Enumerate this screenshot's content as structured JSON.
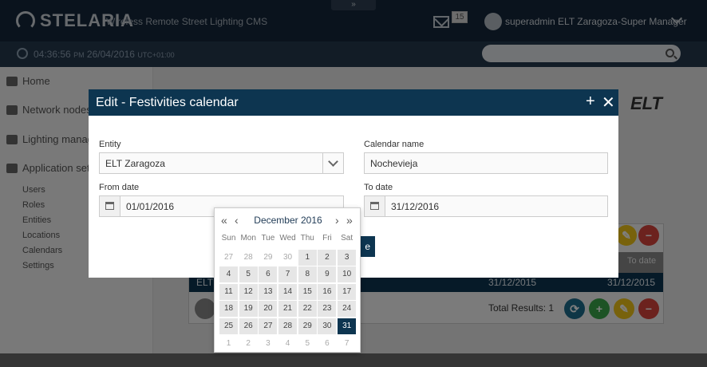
{
  "topbar": {
    "collapse_glyph": "»",
    "brand": "STELARIA",
    "subtitle": "Wireless Remote Street Lighting CMS",
    "mail_count": "15",
    "user": "superadmin  ELT Zaragoza-Super Manager"
  },
  "clock": {
    "time": "04:36:56",
    "ampm": "PM",
    "date": "26/04/2016",
    "tz": "UTC+01:00"
  },
  "sidebar": {
    "items": [
      {
        "label": "Home",
        "icon": "home-icon"
      },
      {
        "label": "Network nodes",
        "icon": "network-icon"
      },
      {
        "label": "Lighting manag",
        "icon": "signal-icon"
      },
      {
        "label": "Application setu",
        "icon": "gear-icon"
      }
    ],
    "subitems": [
      "Users",
      "Roles",
      "Entities",
      "Locations",
      "Calendars",
      "Settings"
    ]
  },
  "background": {
    "brand_logo": "ELT",
    "table_header_to_date": "To date",
    "row_entity": "ELT",
    "row_from": "31/12/2015",
    "row_to": "31/12/2015",
    "total": "Total Results: 1"
  },
  "modal": {
    "title": "Edit - Festivities calendar",
    "plus_glyph": "+",
    "close_glyph": "✕",
    "entity_label": "Entity",
    "entity_value": "ELT Zaragoza",
    "calendar_name_label": "Calendar name",
    "calendar_name_value": "Nochevieja",
    "from_label": "From date",
    "from_value": "01/01/2016",
    "to_label": "To date",
    "to_value": "31/12/2016",
    "save_fragment": "e"
  },
  "datepicker": {
    "month_title": "December 2016",
    "prev_year": "«",
    "prev_month": "‹",
    "next_month": "›",
    "next_year": "»",
    "weekdays": [
      "Sun",
      "Mon",
      "Tue",
      "Wed",
      "Thu",
      "Fri",
      "Sat"
    ],
    "selected_day": "31",
    "days": [
      {
        "d": "27",
        "other": true
      },
      {
        "d": "28",
        "other": true
      },
      {
        "d": "29",
        "other": true
      },
      {
        "d": "30",
        "other": true
      },
      {
        "d": "1"
      },
      {
        "d": "2"
      },
      {
        "d": "3"
      },
      {
        "d": "4"
      },
      {
        "d": "5"
      },
      {
        "d": "6"
      },
      {
        "d": "7"
      },
      {
        "d": "8"
      },
      {
        "d": "9"
      },
      {
        "d": "10"
      },
      {
        "d": "11"
      },
      {
        "d": "12"
      },
      {
        "d": "13"
      },
      {
        "d": "14"
      },
      {
        "d": "15"
      },
      {
        "d": "16"
      },
      {
        "d": "17"
      },
      {
        "d": "18"
      },
      {
        "d": "19"
      },
      {
        "d": "20"
      },
      {
        "d": "21"
      },
      {
        "d": "22"
      },
      {
        "d": "23"
      },
      {
        "d": "24"
      },
      {
        "d": "25"
      },
      {
        "d": "26"
      },
      {
        "d": "27"
      },
      {
        "d": "28"
      },
      {
        "d": "29"
      },
      {
        "d": "30"
      },
      {
        "d": "31"
      },
      {
        "d": "1",
        "other": true
      },
      {
        "d": "2",
        "other": true
      },
      {
        "d": "3",
        "other": true
      },
      {
        "d": "4",
        "other": true
      },
      {
        "d": "5",
        "other": true
      },
      {
        "d": "6",
        "other": true
      },
      {
        "d": "7",
        "other": true
      }
    ]
  },
  "colors": {
    "primary": "#0d3550",
    "topbar": "#14263a",
    "refresh": "#1c6c8c",
    "add": "#3aa64a",
    "edit": "#f0c419",
    "delete": "#d9453d"
  }
}
